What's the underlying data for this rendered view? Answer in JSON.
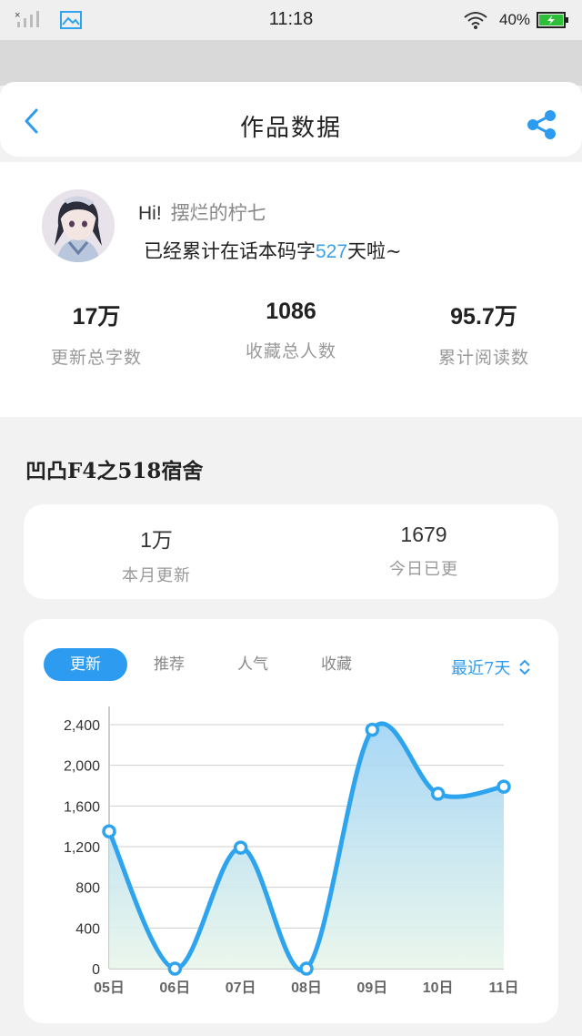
{
  "status_bar": {
    "time": "11:18",
    "battery": "40%",
    "signal_icon": "signal-off-icon",
    "photo_icon": "photo-icon",
    "wifi_icon": "wifi-icon",
    "battery_icon": "battery-charging-icon"
  },
  "header": {
    "title": "作品数据",
    "back_icon": "chevron-left-icon",
    "share_icon": "share-icon"
  },
  "profile": {
    "hi": "Hi!",
    "username": "摆烂的柠七",
    "days_prefix": "已经累计在话本码字",
    "days": "527",
    "days_suffix": "天啦~",
    "stats": [
      {
        "value": "17万",
        "label": "更新总字数"
      },
      {
        "value": "1086",
        "label": "收藏总人数"
      },
      {
        "value": "95.7万",
        "label": "累计阅读数"
      }
    ]
  },
  "book": {
    "title": "凹凸F4之518宿舍",
    "month_stats": [
      {
        "value": "1万",
        "label": "本月更新"
      },
      {
        "value": "1679",
        "label": "今日已更"
      }
    ]
  },
  "chart_tabs": [
    {
      "label": "更新",
      "active": true
    },
    {
      "label": "推荐",
      "active": false
    },
    {
      "label": "人气",
      "active": false
    },
    {
      "label": "收藏",
      "active": false
    }
  ],
  "range_selector": {
    "label": "最近7天",
    "icon": "up-down-chevron-icon"
  },
  "colors": {
    "accent": "#2d9cf0",
    "line": "#2ea4ee"
  },
  "chart_data": {
    "type": "area",
    "categories": [
      "05日",
      "06日",
      "07日",
      "08日",
      "09日",
      "10日",
      "11日"
    ],
    "values": [
      1350,
      0,
      1190,
      0,
      2350,
      1720,
      1790
    ],
    "ylim": [
      0,
      2400
    ],
    "yticks": [
      "0",
      "400",
      "800",
      "1,200",
      "1,600",
      "2,000",
      "2,400"
    ],
    "ytick_values": [
      0,
      400,
      800,
      1200,
      1600,
      2000,
      2400
    ],
    "grid": true,
    "smooth": true
  }
}
